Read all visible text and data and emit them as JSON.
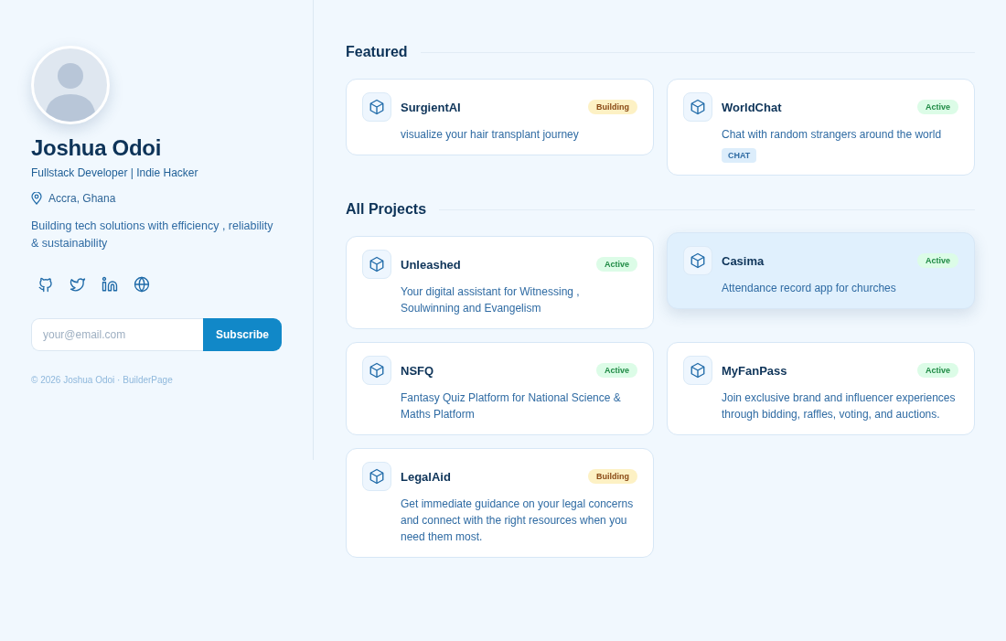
{
  "profile": {
    "name": "Joshua Odoi",
    "role": "Fullstack Developer | Indie Hacker",
    "location": "Accra, Ghana",
    "bio": "Building tech solutions with efficiency , reliability & sustainability",
    "socials": [
      {
        "kind": "github"
      },
      {
        "kind": "twitter"
      },
      {
        "kind": "linkedin"
      },
      {
        "kind": "web"
      }
    ],
    "email_placeholder": "your@email.com",
    "subscribe": "Subscribe",
    "footer": "© 2026 Joshua Odoi · BuilderPage"
  },
  "featured": {
    "title": "Featured",
    "projects": [
      {
        "name": "SurgientAI",
        "status": "Building",
        "kind": "building",
        "description": "visualize your hair transplant journey",
        "hovered": false
      },
      {
        "name": "WorldChat",
        "status": "Active",
        "kind": "active",
        "description": "Chat with random strangers around the world",
        "hovered": false,
        "tags": [
          "CHAT"
        ]
      }
    ]
  },
  "all_projects": {
    "title": "All Projects",
    "projects": [
      {
        "name": "Unleashed",
        "status": "Active",
        "kind": "active",
        "description": "Your digital assistant for Witnessing , Soulwinning and Evangelism",
        "hovered": false
      },
      {
        "name": "Casima",
        "status": "Active",
        "kind": "active",
        "description": "Attendance record app for churches",
        "hovered": true
      },
      {
        "name": "NSFQ",
        "status": "Active",
        "kind": "active",
        "description": "Fantasy Quiz Platform for National Science & Maths Platform",
        "hovered": false
      },
      {
        "name": "MyFanPass",
        "status": "Active",
        "kind": "active",
        "description": "Join exclusive brand and influencer experiences through bidding, raffles, voting, and auctions.",
        "hovered": false
      },
      {
        "name": "LegalAid",
        "status": "Building",
        "kind": "building",
        "description": "Get immediate guidance on your legal concerns and connect with the right resources when you need them most.",
        "hovered": false
      }
    ]
  }
}
